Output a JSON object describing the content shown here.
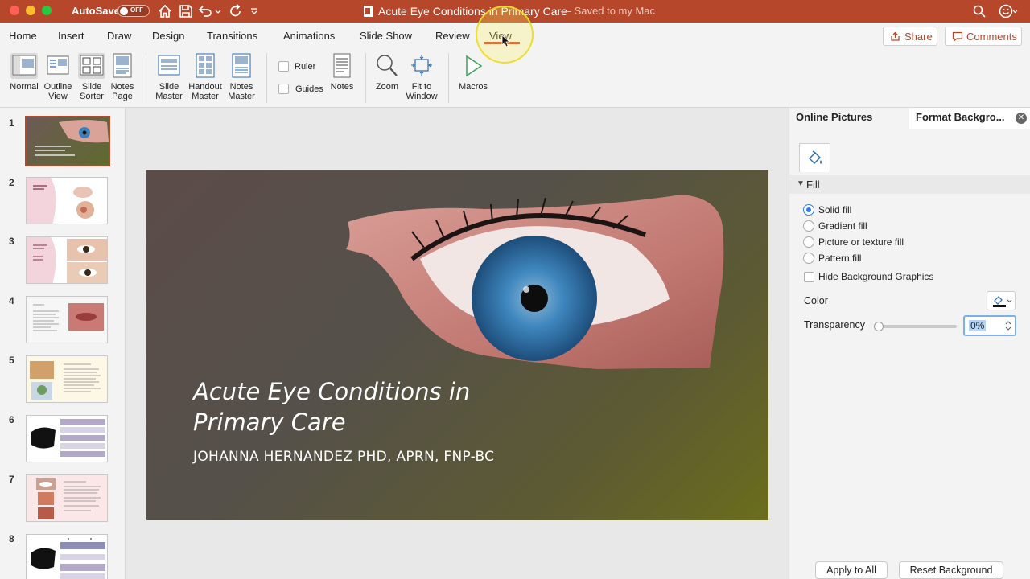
{
  "titlebar": {
    "autosave_label": "AutoSave",
    "autosave_state": "OFF",
    "doc_title": "Acute Eye Conditions in Primary Care",
    "doc_status": "— Saved to my Mac",
    "bg_color": "#b7472a"
  },
  "tabs": {
    "items": [
      "Home",
      "Insert",
      "Draw",
      "Design",
      "Transitions",
      "Animations",
      "Slide Show",
      "Review",
      "View"
    ],
    "active": "View",
    "share_label": "Share",
    "comments_label": "Comments"
  },
  "ribbon": {
    "normal": "Normal",
    "outline_view": "Outline View",
    "slide_sorter": "Slide Sorter",
    "notes_page": "Notes Page",
    "slide_master": "Slide Master",
    "handout_master": "Handout Master",
    "notes_master": "Notes Master",
    "ruler": "Ruler",
    "guides": "Guides",
    "notes": "Notes",
    "zoom": "Zoom",
    "fit_to_window": "Fit to Window",
    "macros": "Macros"
  },
  "thumbnails": {
    "numbers": [
      "1",
      "2",
      "3",
      "4",
      "5",
      "6",
      "7",
      "8"
    ],
    "selected": 1
  },
  "slide": {
    "title": "Acute Eye Conditions in Primary Care",
    "subtitle": "JOHANNA HERNANDEZ PHD, APRN, FNP-BC"
  },
  "pane": {
    "tab_online_pictures": "Online Pictures",
    "tab_format_background": "Format Backgro...",
    "section_fill": "Fill",
    "options": [
      "Solid fill",
      "Gradient fill",
      "Picture or texture fill",
      "Pattern fill"
    ],
    "selected_option": "Solid fill",
    "hide_background_graphics": "Hide Background Graphics",
    "color_label": "Color",
    "transparency_label": "Transparency",
    "transparency_value": "0%",
    "transparency_fraction": 0,
    "apply_to_all": "Apply to All",
    "reset_background": "Reset Background"
  }
}
